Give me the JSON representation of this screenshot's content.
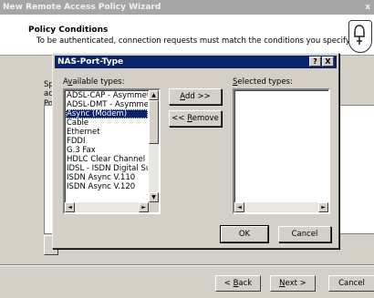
{
  "wizard": {
    "title": "New Remote Access Policy Wizard",
    "close_glyph": "x",
    "heading": "Policy Conditions",
    "subheading": "To be authenticated, connection requests must match the conditions you specify.",
    "bg_label_1": "Sp",
    "bg_label_2": "ac",
    "bg_label_3": "Po",
    "back_label": "< Back",
    "next_label": "Next >",
    "cancel_label": "Cancel"
  },
  "dialog": {
    "title": "NAS-Port-Type",
    "help_glyph": "?",
    "close_glyph": "X",
    "available_label": "Available types:",
    "selected_label": "Selected types:",
    "add_label": "Add >>",
    "remove_label": "<< Remove",
    "ok_label": "OK",
    "cancel_label": "Cancel",
    "available_items": [
      "ADSL-CAP - Asymmetri",
      "ADSL-DMT - Asymmetri",
      "Async (Modem)",
      "Cable",
      "Ethernet",
      "FDDI",
      "G.3 Fax",
      "HDLC Clear Channel",
      "IDSL - ISDN Digital Su",
      "ISDN Async V.110",
      "ISDN Async V.120"
    ],
    "selected_index": 2,
    "selected_items": []
  }
}
